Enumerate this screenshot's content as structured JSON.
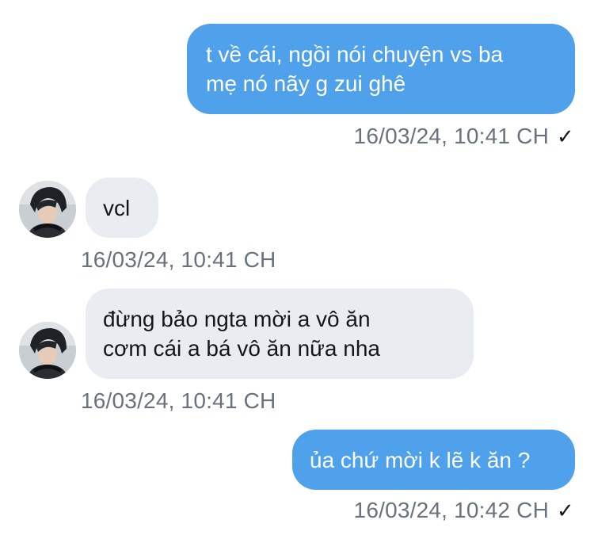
{
  "messages": [
    {
      "direction": "outgoing",
      "text": "t về cái, ngồi nói chuyện vs ba\nmẹ nó nãy g zui ghê",
      "timestamp": "16/03/24, 10:41 CH",
      "status": "✓"
    },
    {
      "direction": "incoming",
      "text": "vcl",
      "timestamp": "16/03/24, 10:41 CH"
    },
    {
      "direction": "incoming",
      "text": "đừng bảo ngta mời a vô ăn\ncơm cái a bá vô ăn nữa nha",
      "timestamp": "16/03/24, 10:41 CH"
    },
    {
      "direction": "outgoing",
      "text": "ủa chứ mời k lẽ k ăn ?",
      "timestamp": "16/03/24, 10:42 CH",
      "status": "✓"
    }
  ],
  "colors": {
    "outgoing_bubble": "#4ea1ea",
    "incoming_bubble": "#e9edf1",
    "timestamp": "#67727e"
  }
}
